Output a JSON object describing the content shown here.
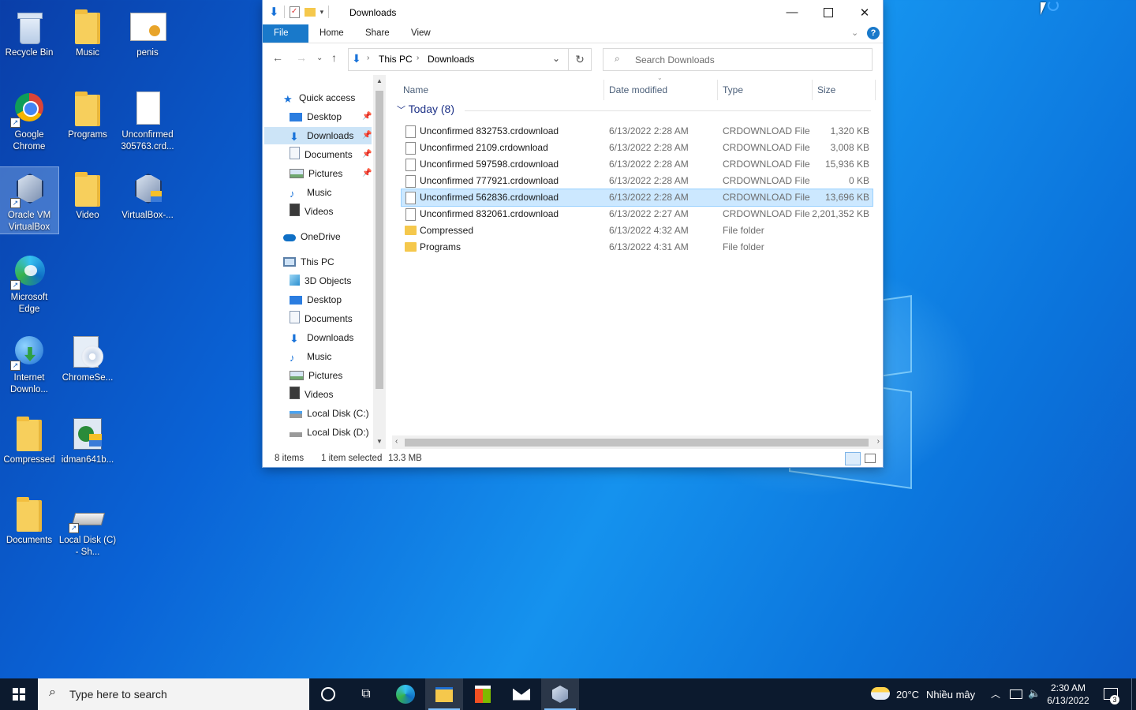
{
  "desktop": {
    "icons": [
      {
        "label": "Recycle Bin"
      },
      {
        "label": "Music"
      },
      {
        "label": "penis"
      },
      {
        "label": "Google Chrome"
      },
      {
        "label": "Programs"
      },
      {
        "label": "Unconfirmed 305763.crd..."
      },
      {
        "label": "Oracle VM VirtualBox"
      },
      {
        "label": "Video"
      },
      {
        "label": "VirtualBox-..."
      },
      {
        "label": "Microsoft Edge"
      },
      {
        "label": "Internet Downlo..."
      },
      {
        "label": "ChromeSe..."
      },
      {
        "label": "Compressed"
      },
      {
        "label": "idman641b..."
      },
      {
        "label": "Documents"
      },
      {
        "label": "Local Disk (C) - Sh..."
      }
    ]
  },
  "explorer": {
    "title": "Downloads",
    "ribbon_tabs": [
      "File",
      "Home",
      "Share",
      "View"
    ],
    "breadcrumb": [
      "This PC",
      "Downloads"
    ],
    "search_placeholder": "Search Downloads",
    "nav": {
      "quick_access": "Quick access",
      "quick_items": [
        "Desktop",
        "Downloads",
        "Documents",
        "Pictures",
        "Music",
        "Videos"
      ],
      "onedrive": "OneDrive",
      "this_pc": "This PC",
      "pc_items": [
        "3D Objects",
        "Desktop",
        "Documents",
        "Downloads",
        "Music",
        "Pictures",
        "Videos",
        "Local Disk (C:)",
        "Local Disk (D:)"
      ]
    },
    "columns": [
      "Name",
      "Date modified",
      "Type",
      "Size"
    ],
    "group_label": "Today (8)",
    "files": [
      {
        "name": "Unconfirmed 832753.crdownload",
        "date": "6/13/2022 2:28 AM",
        "type": "CRDOWNLOAD File",
        "size": "1,320 KB",
        "kind": "file"
      },
      {
        "name": "Unconfirmed 2109.crdownload",
        "date": "6/13/2022 2:28 AM",
        "type": "CRDOWNLOAD File",
        "size": "3,008 KB",
        "kind": "file"
      },
      {
        "name": "Unconfirmed 597598.crdownload",
        "date": "6/13/2022 2:28 AM",
        "type": "CRDOWNLOAD File",
        "size": "15,936 KB",
        "kind": "file"
      },
      {
        "name": "Unconfirmed 777921.crdownload",
        "date": "6/13/2022 2:28 AM",
        "type": "CRDOWNLOAD File",
        "size": "0 KB",
        "kind": "file"
      },
      {
        "name": "Unconfirmed 562836.crdownload",
        "date": "6/13/2022 2:28 AM",
        "type": "CRDOWNLOAD File",
        "size": "13,696 KB",
        "kind": "file",
        "selected": true
      },
      {
        "name": "Unconfirmed 832061.crdownload",
        "date": "6/13/2022 2:27 AM",
        "type": "CRDOWNLOAD File",
        "size": "2,201,352 KB",
        "kind": "file"
      },
      {
        "name": "Compressed",
        "date": "6/13/2022 4:32 AM",
        "type": "File folder",
        "size": "",
        "kind": "folder"
      },
      {
        "name": "Programs",
        "date": "6/13/2022 4:31 AM",
        "type": "File folder",
        "size": "",
        "kind": "folder"
      }
    ],
    "status": {
      "count": "8 items",
      "selected": "1 item selected",
      "size": "13.3 MB"
    }
  },
  "taskbar": {
    "search_placeholder": "Type here to search",
    "weather": "20°C",
    "weather_desc": "Nhiều mây",
    "time": "2:30 AM",
    "date": "6/13/2022",
    "notification_count": "3"
  },
  "colors": {
    "accent": "#1979ca",
    "selection": "#cce8ff",
    "taskbar": "#0c1a2e"
  }
}
